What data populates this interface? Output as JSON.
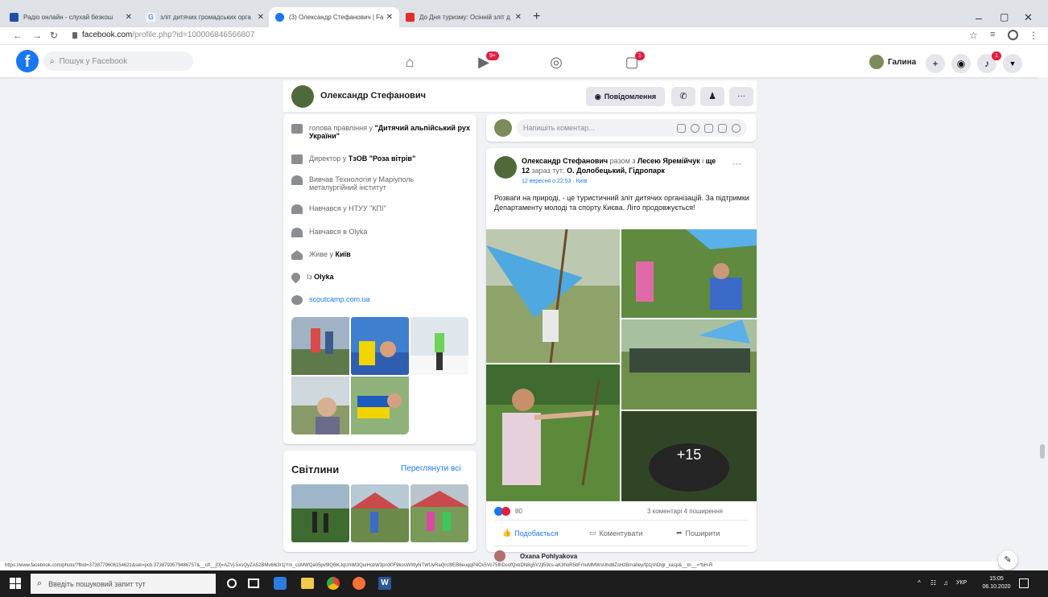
{
  "browser": {
    "tabs": [
      {
        "title": "Радіо онлайн - слухай безкош",
        "favicon_color": "#1f4fa8"
      },
      {
        "title": "зліт дитячих громадських орга",
        "favicon_color": "#4285f4"
      },
      {
        "title": "(3) Олександр Стефанович | Fa",
        "favicon_color": "#1877f2"
      },
      {
        "title": "До Дня туризму: Осінній зліт д",
        "favicon_color": "#e52d27"
      }
    ],
    "new_tab": "+",
    "url_host": "facebook.com",
    "url_path": "/profile.php?id=100006846566807",
    "status_url": "https://www.facebook.com/photo/?fbid=3738779606154621&set=pcb.3738793579486757&__cft__[0]=AZVj-5xsQyZA52BMv66i3r1jYm_cuMWQa05pv9lQBKJqUmM3QuiHsbW3pn30F9kosWWyNTWUvRaQrcl9EB6euqqP4Ck5Vo75fhDsofQxkDN8g5V2jl59cs-aK3hoR5bFmuMMWsUhd8ZsHzBrnaIley/tp1jViOlgr_xasp&__tn__=*bH-R"
  },
  "facebook_nav": {
    "search_placeholder": "Пошук у Facebook",
    "watch_badge": "9+",
    "gaming_badge": "1",
    "user_name": "Галина",
    "notif_badge": "1"
  },
  "profile": {
    "name": "Олександр Стефанович",
    "message_label": "Повідомлення",
    "more_label": "···"
  },
  "intro": {
    "rows": [
      {
        "prefix": "голова правління у ",
        "bold": "\"Дитячий альпійський рух України\""
      },
      {
        "prefix": "Директор у ",
        "bold": "ТзОВ \"Роза вітрів\""
      },
      {
        "prefix": "Вивчав Технологія у Маріуполь металургійний інститут",
        "bold": ""
      },
      {
        "prefix": "Навчався у НТУУ \"КПІ\"",
        "bold": ""
      },
      {
        "prefix": "Навчався в Olyka",
        "bold": ""
      },
      {
        "prefix": "Живе у ",
        "bold": "Київ"
      },
      {
        "prefix": "Із ",
        "bold": "Olyka"
      },
      {
        "prefix": "scoutcamp.com.ua",
        "bold": ""
      }
    ]
  },
  "photos_section": {
    "title": "Світлини",
    "see_all": "Переглянути всі"
  },
  "composer": {
    "placeholder": "Напишіть коментар..."
  },
  "post": {
    "author": "Олександр Стефанович",
    "with_word": "разом з",
    "tagged": "Лесею Яремійчук",
    "others_prefix": "і",
    "others": "ще 12",
    "at_word": "зараз тут:",
    "place": "О. Долобецький, Гідропарк",
    "date": "12 вересня о 22:53 · Київ",
    "text": "Розваги на природі, - це туристичний зліт дитячих організацій. За підтримки Департаменту молоді та спорту Києва. Літо продовжується!",
    "more_count": "+15",
    "reactions_count": "80",
    "comments_shares": "3 коментарі 4 поширення",
    "like_label": "Подобається",
    "comment_label": "Коментувати",
    "share_label": "Поширити",
    "commenter": "Oxana Pohlyakova",
    "options": "···"
  },
  "taskbar": {
    "search_placeholder": "Введіть пошуковий запит тут",
    "lang": "УКР",
    "time": "15:05",
    "date": "06.10.2020"
  },
  "colors": {
    "fb_blue": "#1877f2",
    "badge_red": "#e41e3f"
  }
}
